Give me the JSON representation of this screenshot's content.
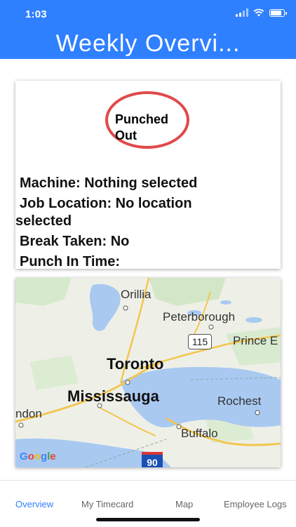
{
  "status_bar": {
    "time": "1:03"
  },
  "header": {
    "title": "Weekly Overvi..."
  },
  "status_card": {
    "punch_status": "Punched Out",
    "machine": "Machine: Nothing selected",
    "job_location_line1": "Job Location: No location",
    "job_location_line2": "selected",
    "break_taken": "Break Taken: No",
    "punch_in_time": "Punch In Time:"
  },
  "map": {
    "labels": {
      "orillia": "Orillia",
      "peterborough": "Peterborough",
      "route_115": "115",
      "prince": "Prince E",
      "toronto": "Toronto",
      "mississauga": "Mississauga",
      "ndon": "ndon",
      "rochester": "Rochest",
      "buffalo": "Buffalo",
      "route_90": "90"
    },
    "attribution": "Google",
    "colors": {
      "water": "#a9c9f1",
      "land": "#eef0e8",
      "park": "#cfe6c5",
      "road": "#f3c64e"
    }
  },
  "tabs": [
    {
      "label": "Overview",
      "active": true
    },
    {
      "label": "My Timecard",
      "active": false
    },
    {
      "label": "Map",
      "active": false
    },
    {
      "label": "Employee Logs",
      "active": false
    }
  ],
  "theme": {
    "accent": "#2f80ff",
    "punched_out_ring": "#e04a4a"
  }
}
